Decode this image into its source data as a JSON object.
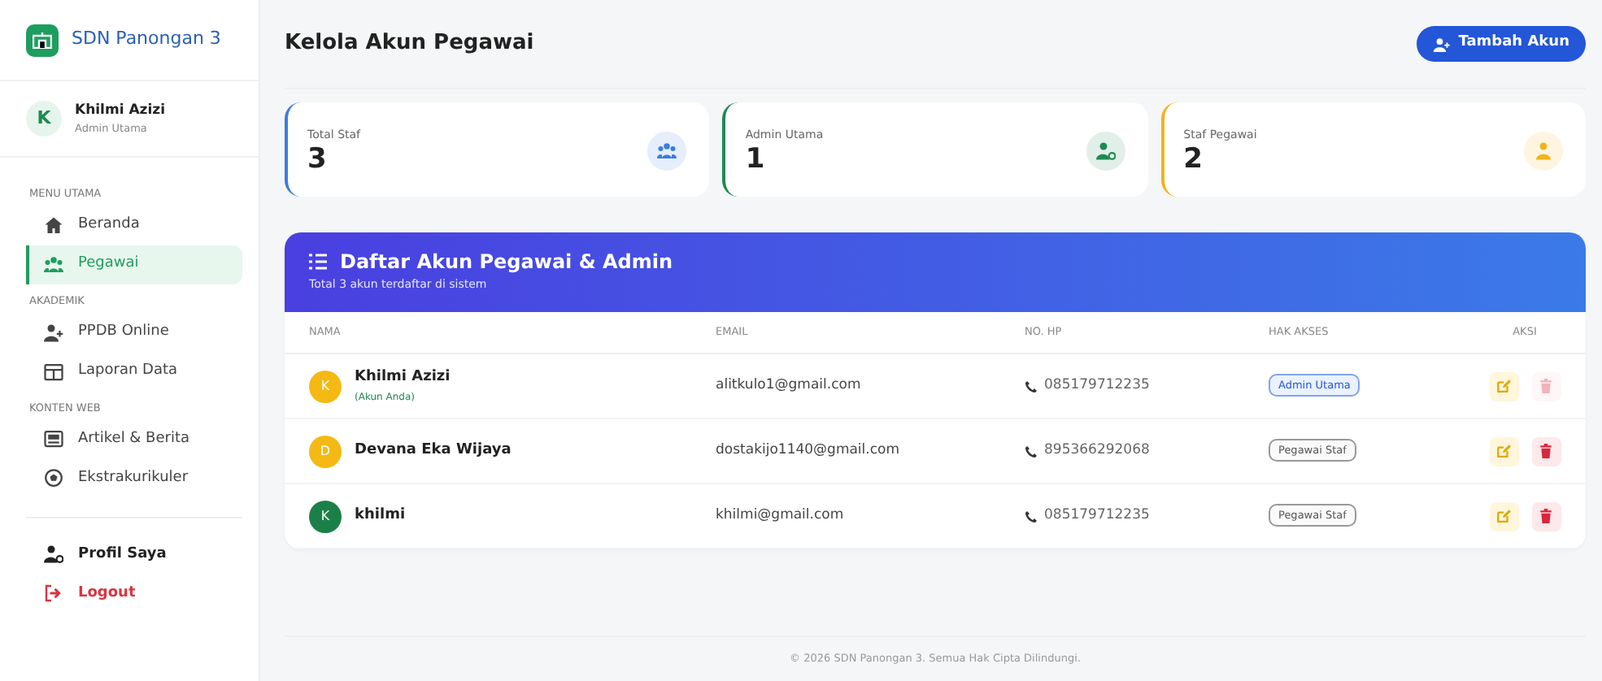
{
  "brand": {
    "title": "SDN Panongan 3"
  },
  "user": {
    "initial": "K",
    "name": "Khilmi Azizi",
    "role": "Admin Utama"
  },
  "sidebar": {
    "sections": [
      {
        "heading": "MENU UTAMA",
        "items": [
          {
            "label": "Beranda",
            "selected": false
          },
          {
            "label": "Pegawai",
            "selected": true
          }
        ]
      },
      {
        "heading": "AKADEMIK",
        "items": [
          {
            "label": "PPDB Online",
            "selected": false
          },
          {
            "label": "Laporan Data",
            "selected": false
          }
        ]
      },
      {
        "heading": "KONTEN WEB",
        "items": [
          {
            "label": "Artikel & Berita",
            "selected": false
          },
          {
            "label": "Ekstrakurikuler",
            "selected": false
          }
        ]
      }
    ],
    "bottom_items": [
      {
        "label": "Profil Saya",
        "kind": "normal"
      },
      {
        "label": "Logout",
        "kind": "danger"
      }
    ]
  },
  "page": {
    "title": "Kelola Akun Pegawai",
    "add_button": "Tambah Akun"
  },
  "stats": [
    {
      "label": "Total Staf",
      "value": "3",
      "color": "#3b7ddd"
    },
    {
      "label": "Admin Utama",
      "value": "1",
      "color": "#1e8a52"
    },
    {
      "label": "Staf Pegawai",
      "value": "2",
      "color": "#f0b41a"
    }
  ],
  "table": {
    "title": "Daftar Akun Pegawai & Admin",
    "subtitle": "Total 3 akun terdaftar di sistem",
    "columns": [
      "NAMA",
      "EMAIL",
      "NO. HP",
      "HAK AKSES",
      "AKSI"
    ],
    "rows": [
      {
        "initial": "K",
        "color": "#f5b914",
        "name": "Khilmi Azizi",
        "note": "(Akun Anda)",
        "email": "alitkulo1@gmail.com",
        "phone": "085179712235",
        "role": {
          "label": "Admin Utama",
          "kind": "admin"
        },
        "delete_disabled": true
      },
      {
        "initial": "D",
        "color": "#f5b914",
        "name": "Devana Eka Wijaya",
        "email": "dostakijo1140@gmail.com",
        "phone": "895366292068",
        "role": {
          "label": "Pegawai Staf",
          "kind": "staff"
        },
        "delete_disabled": false
      },
      {
        "initial": "K",
        "color": "#1a8048",
        "name": "khilmi",
        "email": "khilmi@gmail.com",
        "phone": "085179712235",
        "role": {
          "label": "Pegawai Staf",
          "kind": "staff"
        },
        "delete_disabled": false
      }
    ]
  },
  "footer": "© 2026 SDN Panongan 3. Semua Hak Cipta Dilindungi."
}
